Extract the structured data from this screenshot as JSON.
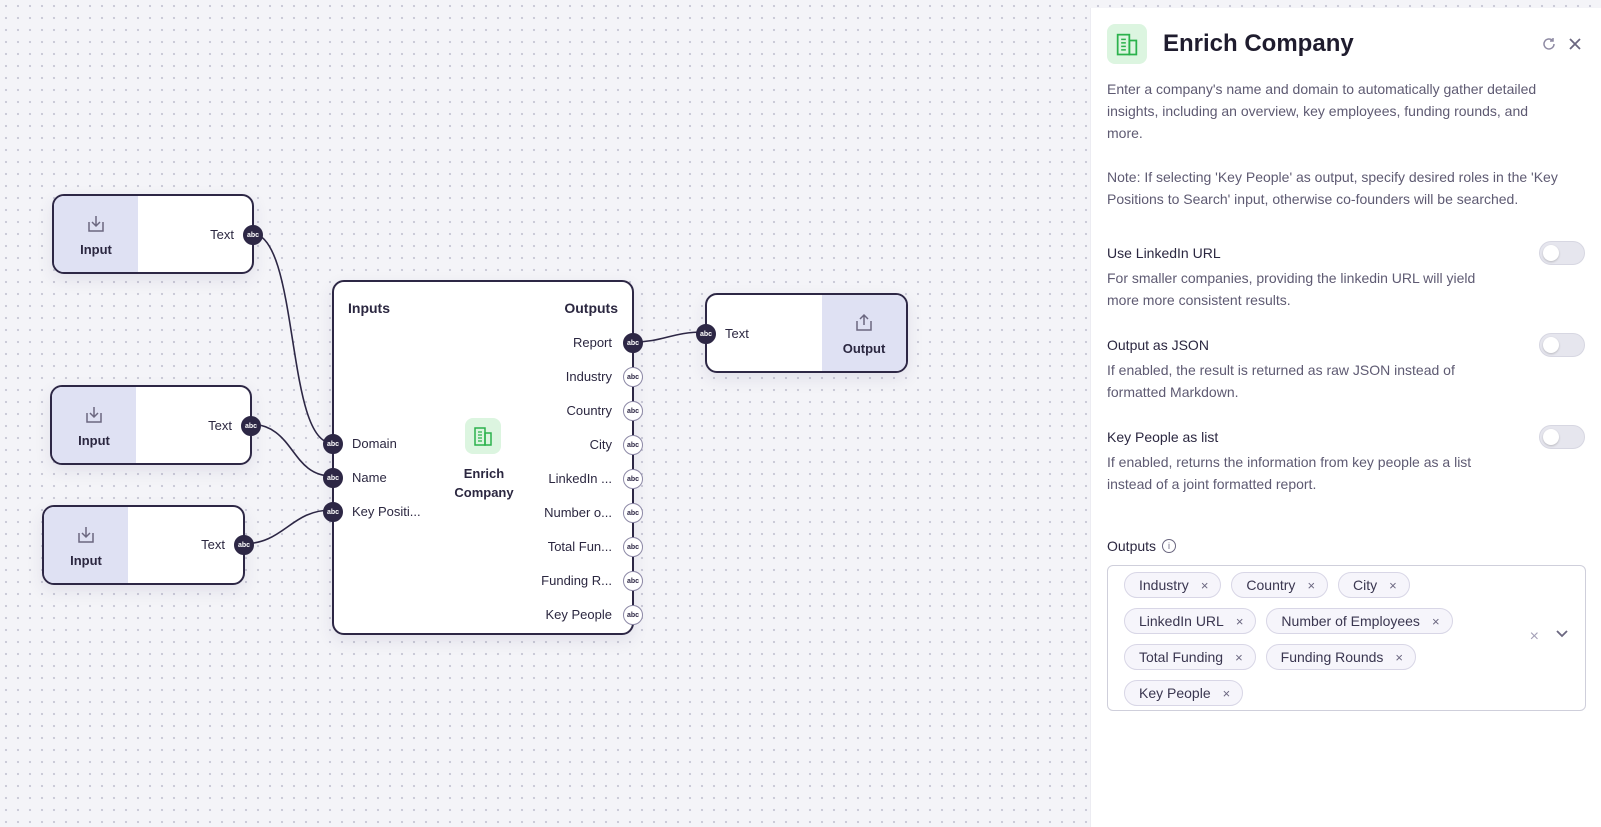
{
  "canvas": {
    "input_nodes": [
      {
        "label": "Input",
        "port_label": "Text",
        "port_type": "abc"
      },
      {
        "label": "Input",
        "port_label": "Text",
        "port_type": "abc"
      },
      {
        "label": "Input",
        "port_label": "Text",
        "port_type": "abc"
      }
    ],
    "main_node": {
      "inputs_header": "Inputs",
      "outputs_header": "Outputs",
      "title": "Enrich Company",
      "icon": "building-icon",
      "inputs": [
        "Domain",
        "Name",
        "Key Positi..."
      ],
      "outputs": [
        "Report",
        "Industry",
        "Country",
        "City",
        "LinkedIn ...",
        "Number o...",
        "Total Fun...",
        "Funding R...",
        "Key People"
      ],
      "port_type": "abc"
    },
    "output_node": {
      "label": "Output",
      "port_label": "Text",
      "port_type": "abc"
    }
  },
  "panel": {
    "title": "Enrich Company",
    "icon": "building-icon",
    "refresh_icon": "refresh-icon",
    "close_icon": "close-icon",
    "description": "Enter a company's name and domain to automatically gather detailed insights, including an overview, key employees, funding rounds, and more.",
    "note": "Note: If selecting 'Key People' as output, specify desired roles in the 'Key Positions to Search' input, otherwise co-founders will be searched.",
    "options": [
      {
        "title": "Use LinkedIn URL",
        "description": "For smaller companies, providing the linkedin URL will yield more more consistent results.",
        "enabled": false
      },
      {
        "title": "Output as JSON",
        "description": "If enabled, the result is returned as raw JSON instead of formatted Markdown.",
        "enabled": false
      },
      {
        "title": "Key People as list",
        "description": "If enabled, returns the information from key people as a list instead of a joint formatted report.",
        "enabled": false
      }
    ],
    "outputs_label": "Outputs",
    "selected_outputs": [
      "Industry",
      "Country",
      "City",
      "LinkedIn URL",
      "Number of Employees",
      "Total Funding",
      "Funding Rounds",
      "Key People"
    ],
    "tag_remove_glyph": "×",
    "clear_glyph": "×"
  },
  "colors": {
    "node_border": "#2d2745",
    "io_pane": "#dfe1f3",
    "accent_green": "#2bb24c",
    "icon_bg": "#dcf5e0"
  }
}
